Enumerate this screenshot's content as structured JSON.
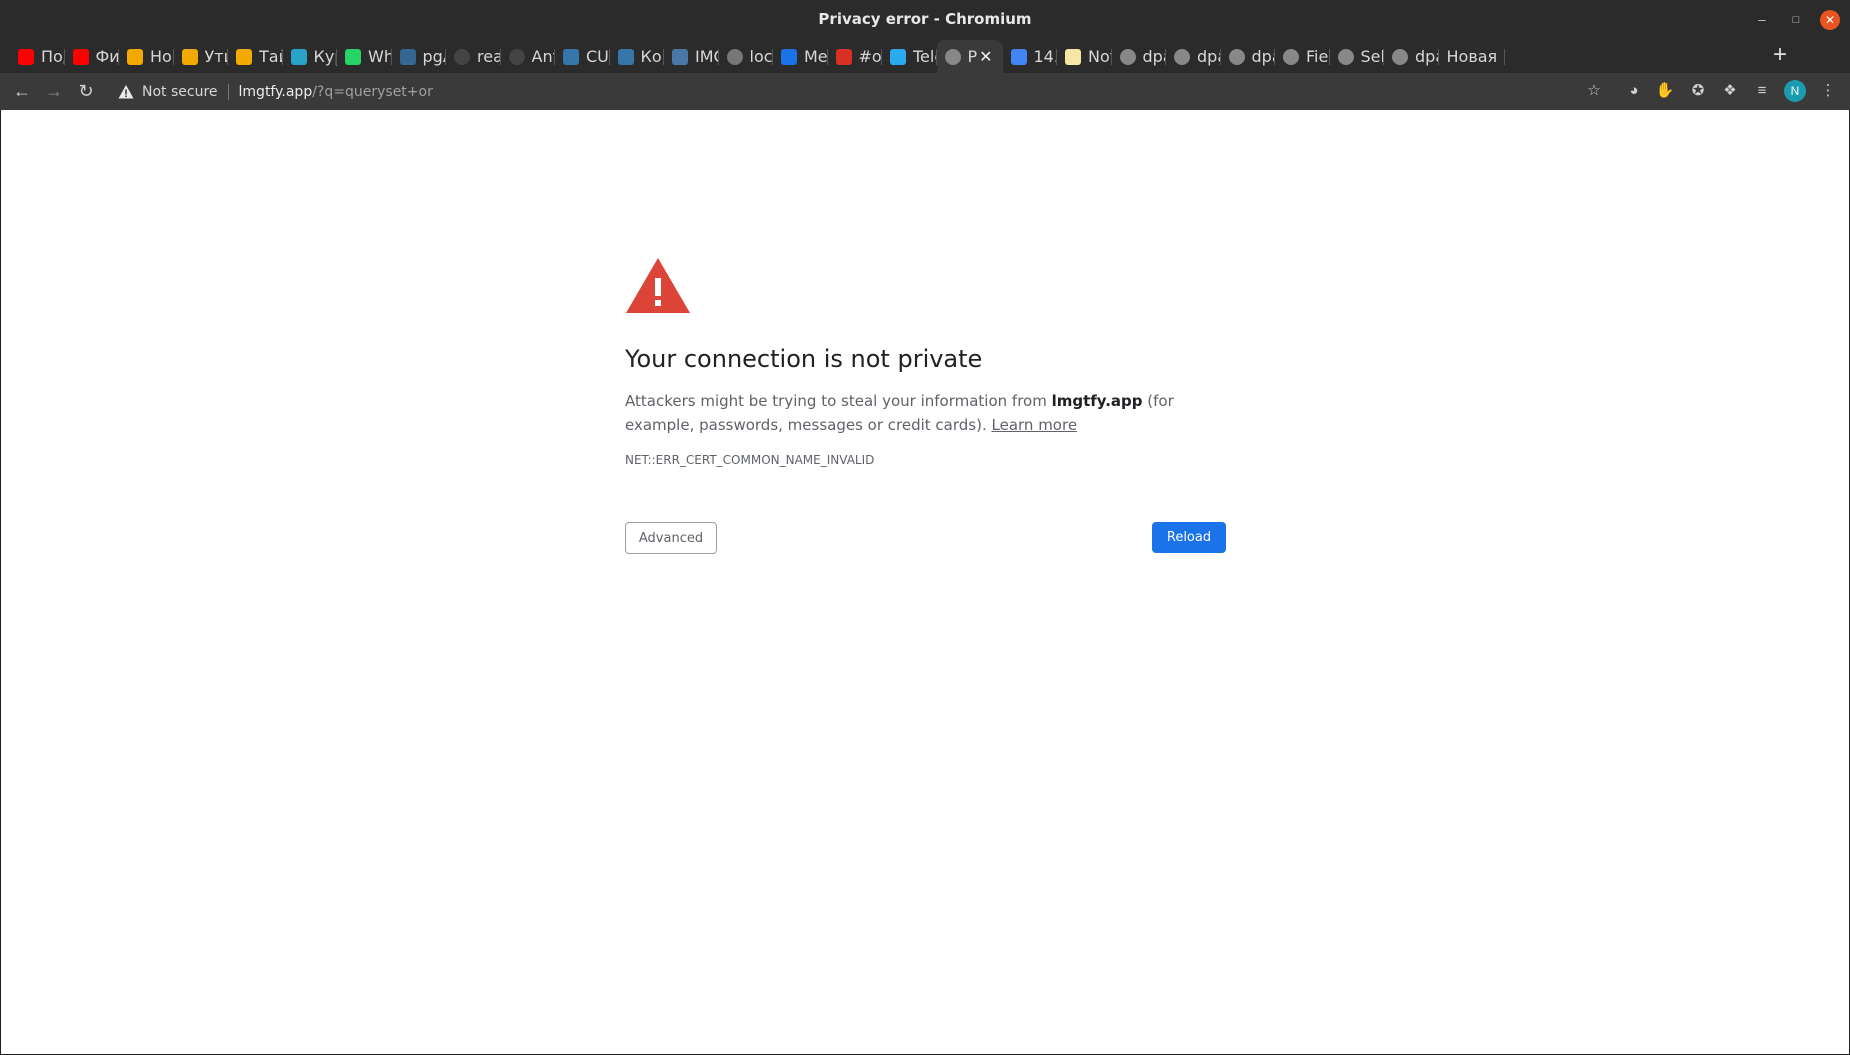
{
  "window": {
    "title": "Privacy error - Chromium"
  },
  "tabs": [
    {
      "label": "Под",
      "icon": "youtube-icon",
      "color": "#ff0000"
    },
    {
      "label": "Фи",
      "icon": "youtube-icon",
      "color": "#ff0000"
    },
    {
      "label": "Нов",
      "icon": "fs-icon",
      "color": "#f2a900"
    },
    {
      "label": "Ути",
      "icon": "fs-icon",
      "color": "#f2a900"
    },
    {
      "label": "Тай",
      "icon": "fs-icon",
      "color": "#f2a900"
    },
    {
      "label": "Кур",
      "icon": "z-icon",
      "color": "#2aa3c9"
    },
    {
      "label": "Wh",
      "icon": "whatsapp-icon",
      "color": "#25d366"
    },
    {
      "label": "pgA",
      "icon": "pg-icon",
      "color": "#336791"
    },
    {
      "label": "real",
      "icon": "github-icon",
      "color": "#444444"
    },
    {
      "label": "Ant",
      "icon": "github-icon",
      "color": "#444444"
    },
    {
      "label": "CUE",
      "icon": "python-icon",
      "color": "#3776ab"
    },
    {
      "label": "Ком",
      "icon": "python-icon",
      "color": "#3776ab"
    },
    {
      "label": "IMC",
      "icon": "vk-icon",
      "color": "#4a76a8"
    },
    {
      "label": "loca",
      "icon": "gear-icon",
      "color": "#777777"
    },
    {
      "label": "Mec",
      "icon": "chat-icon",
      "color": "#1a73e8"
    },
    {
      "label": "#oc",
      "icon": "calendar-icon",
      "color": "#d93025"
    },
    {
      "label": "Tele",
      "icon": "telegram-icon",
      "color": "#2aabee"
    },
    {
      "label": "P",
      "icon": "globe-icon",
      "color": "#888888",
      "active": true
    },
    {
      "label": "14.",
      "icon": "docs-icon",
      "color": "#4285f4"
    },
    {
      "label": "Not",
      "icon": "note-icon",
      "color": "#f6e7a6"
    },
    {
      "label": "dpa",
      "icon": "globe-icon",
      "color": "#888888"
    },
    {
      "label": "dpa",
      "icon": "globe-icon",
      "color": "#888888"
    },
    {
      "label": "dpa",
      "icon": "globe-icon",
      "color": "#888888"
    },
    {
      "label": "Fiel",
      "icon": "globe-icon",
      "color": "#888888"
    },
    {
      "label": "Sele",
      "icon": "globe-icon",
      "color": "#888888"
    },
    {
      "label": "dpa",
      "icon": "globe-icon",
      "color": "#888888"
    },
    {
      "label": "Новая",
      "icon": "",
      "color": ""
    }
  ],
  "toolbar": {
    "security_label": "Not secure",
    "url_host": "lmgtfy.app",
    "url_rest": "/?q=queryset+or",
    "avatar_initial": "N"
  },
  "page": {
    "heading": "Your connection is not private",
    "message_before": "Attackers might be trying to steal your information from ",
    "message_host": "lmgtfy.app",
    "message_after": " (for example, passwords, messages or credit cards). ",
    "learn_more": "Learn more",
    "error_code": "NET::ERR_CERT_COMMON_NAME_INVALID",
    "advanced_label": "Advanced",
    "reload_label": "Reload"
  },
  "colors": {
    "warning_red": "#db4437",
    "reload_blue": "#1a73e8",
    "close_orange": "#e95420"
  }
}
